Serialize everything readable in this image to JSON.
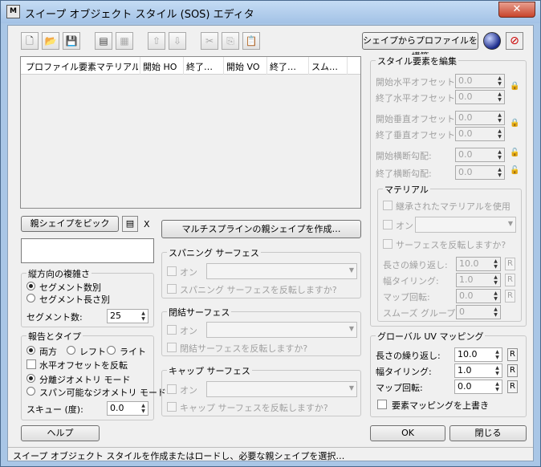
{
  "window": {
    "title": "スイープ オブジェクト スタイル (SOS) エディタ",
    "icon_text": "M"
  },
  "toolbar": {
    "build_profile_button": "シェイプからプロファイルを構築"
  },
  "list": {
    "columns": [
      "プロファイル要素マテリアル",
      "開始 HO",
      "終了…",
      "開始 VO",
      "終了…",
      "スム…"
    ]
  },
  "pick": {
    "button": "親シェイプをピック",
    "x": "X",
    "name_value": ""
  },
  "multispline_button": "マルチスプラインの親シェイプを作成…",
  "length_complexity": {
    "title": "縦方向の複雑さ",
    "radio1": "セグメント数別",
    "radio2": "セグメント長さ別",
    "seg_label": "セグメント数:",
    "seg_value": "25"
  },
  "report_type": {
    "title": "報告とタイプ",
    "both": "両方",
    "left": "レフト",
    "right": "ライト",
    "flip_h": "水平オフセットを反転",
    "split": "分離ジオメトリ モード",
    "spanable": "スパン可能なジオメトリ モード",
    "skew_label": "スキュー (度):",
    "skew_value": "0.0"
  },
  "spanning": {
    "title": "スパニング サーフェス",
    "on": "オン",
    "flip": "スパニング サーフェスを反転しますか?"
  },
  "closing": {
    "title": "閉結サーフェス",
    "on": "オン",
    "flip": "閉結サーフェスを反転しますか?"
  },
  "cap": {
    "title": "キャップ サーフェス",
    "on": "オン",
    "flip": "キャップ サーフェスを反転しますか?"
  },
  "style_edit": {
    "title": "スタイル要素を編集",
    "start_h": "開始水平オフセット:",
    "start_h_val": "0.0",
    "end_h": "終了水平オフセット:",
    "end_h_val": "0.0",
    "start_v": "開始垂直オフセット:",
    "start_v_val": "0.0",
    "end_v": "終了垂直オフセット:",
    "end_v_val": "0.0",
    "start_slope": "開始横断勾配:",
    "start_slope_val": "0.0",
    "end_slope": "終了横断勾配:",
    "end_slope_val": "0.0"
  },
  "material": {
    "title": "マテリアル",
    "inherit": "継承されたマテリアルを使用",
    "on": "オン",
    "flip": "サーフェスを反転しますか?",
    "length_repeat": "長さの繰り返し:",
    "length_repeat_val": "10.0",
    "width_tile": "幅タイリング:",
    "width_tile_val": "1.0",
    "map_rot": "マップ回転:",
    "map_rot_val": "0.0",
    "smooth": "スムーズ グループ:",
    "smooth_val": "0",
    "r": "R"
  },
  "global_uv": {
    "title": "グローバル UV マッピング",
    "length_repeat": "長さの繰り返し:",
    "length_repeat_val": "10.0",
    "width_tile": "幅タイリング:",
    "width_tile_val": "1.0",
    "map_rot": "マップ回転:",
    "map_rot_val": "0.0",
    "override": "要素マッピングを上書き",
    "r": "R"
  },
  "buttons": {
    "help": "ヘルプ",
    "ok": "OK",
    "close": "閉じる"
  },
  "status": "スイープ オブジェクト スタイルを作成またはロードし、必要な親シェイプを選択…",
  "colors": {
    "titlebar": "#a9c6e6",
    "close_button": "#c8442c",
    "lock": "#cc0000"
  }
}
